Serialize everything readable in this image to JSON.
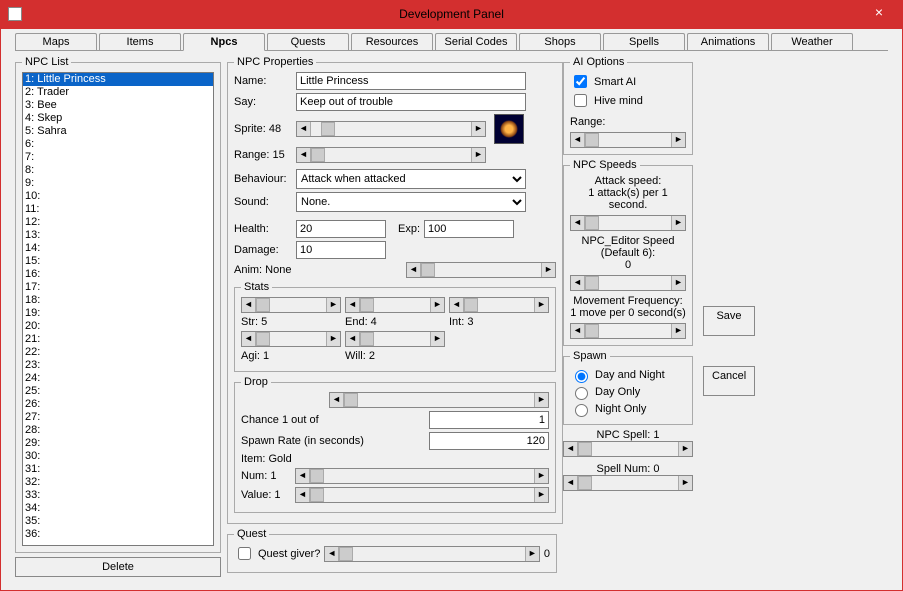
{
  "window": {
    "title": "Development Panel"
  },
  "tabs": [
    "Maps",
    "Items",
    "Npcs",
    "Quests",
    "Resources",
    "Serial Codes",
    "Shops",
    "Spells",
    "Animations",
    "Weather"
  ],
  "activeTab": "Npcs",
  "npcList": {
    "legend": "NPC List",
    "items": [
      "1: Little Princess",
      "2: Trader",
      "3: Bee",
      "4: Skep",
      "5: Sahra",
      "6:",
      "7:",
      "8:",
      "9:",
      "10:",
      "11:",
      "12:",
      "13:",
      "14:",
      "15:",
      "16:",
      "17:",
      "18:",
      "19:",
      "20:",
      "21:",
      "22:",
      "23:",
      "24:",
      "25:",
      "26:",
      "27:",
      "28:",
      "29:",
      "30:",
      "31:",
      "32:",
      "33:",
      "34:",
      "35:",
      "36:"
    ],
    "selected": 0,
    "deleteBtn": "Delete"
  },
  "props": {
    "legend": "NPC Properties",
    "nameLbl": "Name:",
    "nameVal": "Little Princess",
    "sayLbl": "Say:",
    "sayVal": "Keep out of trouble",
    "spriteLbl": "Sprite: 48",
    "rangeLbl": "Range: 15",
    "behaviourLbl": "Behaviour:",
    "behaviourVal": "Attack when attacked",
    "soundLbl": "Sound:",
    "soundVal": "None.",
    "healthLbl": "Health:",
    "healthVal": "20",
    "expLbl": "Exp:",
    "expVal": "100",
    "damageLbl": "Damage:",
    "damageVal": "10",
    "animLbl": "Anim: None"
  },
  "stats": {
    "legend": "Stats",
    "str": "Str: 5",
    "end": "End: 4",
    "int": "Int: 3",
    "agi": "Agi: 1",
    "will": "Will: 2"
  },
  "drop": {
    "legend": "Drop",
    "chanceLbl": "Chance 1 out of",
    "chanceVal": "1",
    "spawnRateLbl": "Spawn Rate (in seconds)",
    "spawnRateVal": "120",
    "itemLbl": "Item: Gold",
    "numLbl": "Num: 1",
    "valueLbl": "Value: 1"
  },
  "quest": {
    "legend": "Quest",
    "giverLbl": "Quest giver?",
    "zero": "0"
  },
  "ai": {
    "legend": "AI Options",
    "smart": "Smart AI",
    "hive": "Hive mind",
    "rangeLbl": "Range:"
  },
  "speeds": {
    "legend": "NPC Speeds",
    "attackSpeed": "Attack speed:",
    "attackVal": "1 attack(s) per 1 second.",
    "editorSpeed": "NPC_Editor Speed (Default 6):",
    "editorVal": "0",
    "moveFreq": "Movement Frequency:",
    "moveVal": "1 move per 0 second(s)"
  },
  "spawn": {
    "legend": "Spawn",
    "opts": [
      "Day and Night",
      "Day Only",
      "Night Only"
    ]
  },
  "spell": {
    "lbl": "NPC Spell: 1",
    "numLbl": "Spell Num: 0"
  },
  "buttons": {
    "save": "Save",
    "cancel": "Cancel"
  }
}
